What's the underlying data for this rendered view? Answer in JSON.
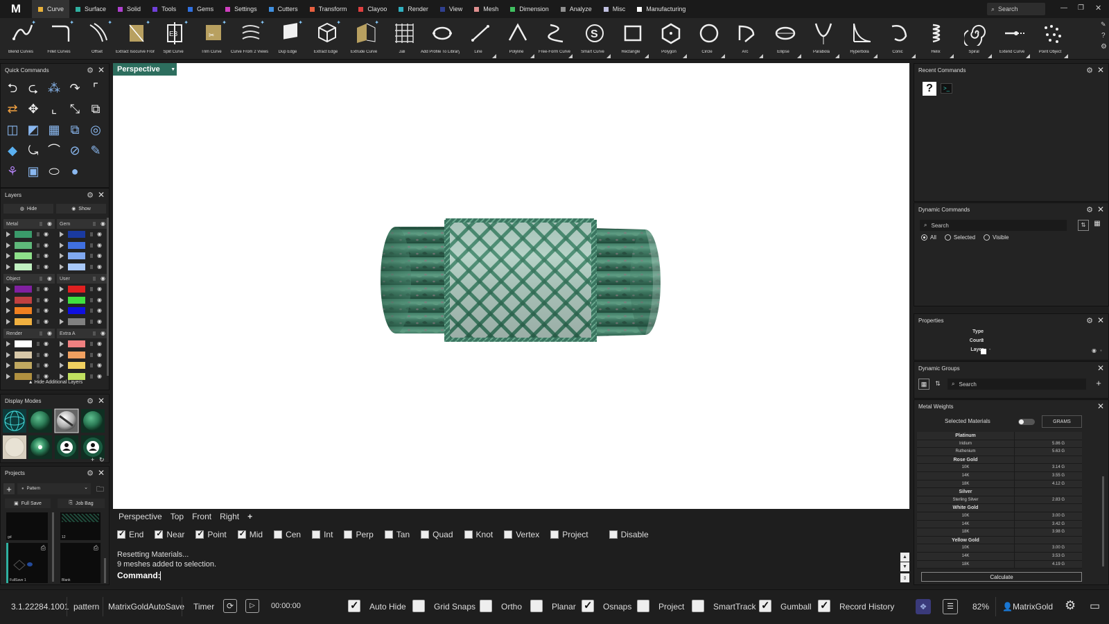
{
  "app": {
    "logo": "M"
  },
  "menubar": {
    "items": [
      {
        "label": "Curve",
        "color": "#e8b13a",
        "active": true
      },
      {
        "label": "Surface",
        "color": "#2fb0a0"
      },
      {
        "label": "Solid",
        "color": "#b040d0"
      },
      {
        "label": "Tools",
        "color": "#7040d8"
      },
      {
        "label": "Gems",
        "color": "#3070e0"
      },
      {
        "label": "Settings",
        "color": "#d040c0"
      },
      {
        "label": "Cutters",
        "color": "#4090e0"
      },
      {
        "label": "Transform",
        "color": "#e86040"
      },
      {
        "label": "Clayoo",
        "color": "#e04040"
      },
      {
        "label": "Render",
        "color": "#30b0c0"
      },
      {
        "label": "View",
        "color": "#304090"
      },
      {
        "label": "Mesh",
        "color": "#e09090"
      },
      {
        "label": "Dimension",
        "color": "#40c060"
      },
      {
        "label": "Analyze",
        "color": "#909090"
      },
      {
        "label": "Misc",
        "color": "#c0c0e0"
      },
      {
        "label": "Manufacturing",
        "color": "#ffffff"
      }
    ],
    "search_placeholder": "Search"
  },
  "toolbar": {
    "tools": [
      {
        "label": "Blend Curves",
        "icon": "blend-curves-icon"
      },
      {
        "label": "Fillet Curves",
        "icon": "fillet-curves-icon"
      },
      {
        "label": "Offset",
        "icon": "offset-icon"
      },
      {
        "label": "Extract Isocurve From...",
        "icon": "extract-isocurve-icon"
      },
      {
        "label": "Split Curve",
        "icon": "split-curve-icon"
      },
      {
        "label": "Trim Curve",
        "icon": "trim-curve-icon"
      },
      {
        "label": "Curve From 2 Views",
        "icon": "curve-from-2-views-icon"
      },
      {
        "label": "Dup Edge",
        "icon": "dup-edge-icon"
      },
      {
        "label": "Extract Edge",
        "icon": "extract-edge-icon"
      },
      {
        "label": "Extrude Curve",
        "icon": "extrude-curve-icon"
      },
      {
        "label": "Jali",
        "icon": "jali-icon"
      },
      {
        "label": "Add Profile To Library",
        "icon": "add-profile-icon"
      },
      {
        "label": "Line",
        "icon": "line-icon"
      },
      {
        "label": "Polyline",
        "icon": "polyline-icon"
      },
      {
        "label": "Free-Form Curve",
        "icon": "free-form-curve-icon"
      },
      {
        "label": "Smart Curve",
        "icon": "smart-curve-icon"
      },
      {
        "label": "Rectangle",
        "icon": "rectangle-icon"
      },
      {
        "label": "Polygon",
        "icon": "polygon-icon"
      },
      {
        "label": "Circle",
        "icon": "circle-icon"
      },
      {
        "label": "Arc",
        "icon": "arc-icon"
      },
      {
        "label": "Ellipse",
        "icon": "ellipse-icon"
      },
      {
        "label": "Parabola",
        "icon": "parabola-icon"
      },
      {
        "label": "Hyperbola",
        "icon": "hyperbola-icon"
      },
      {
        "label": "Conic",
        "icon": "conic-icon"
      },
      {
        "label": "Helix",
        "icon": "helix-icon"
      },
      {
        "label": "Spiral",
        "icon": "spiral-icon"
      },
      {
        "label": "Extend Curve",
        "icon": "extend-curve-icon"
      },
      {
        "label": "Point Object",
        "icon": "point-object-icon"
      }
    ]
  },
  "quick_commands": {
    "title": "Quick Commands"
  },
  "layers": {
    "title": "Layers",
    "hide_label": "Hide",
    "show_label": "Show",
    "groups": [
      {
        "name": "Metal",
        "colors": [
          "#3a9a6a",
          "#5fb87a",
          "#8ee08a",
          "#c0f0c0"
        ]
      },
      {
        "name": "Gem",
        "colors": [
          "#1a3aa0",
          "#4070e0",
          "#80a8f0",
          "#a8c8f8"
        ]
      },
      {
        "name": "Object",
        "colors": [
          "#8020a0",
          "#c04040",
          "#f08020",
          "#f0b040"
        ]
      },
      {
        "name": "User",
        "colors": [
          "#e02020",
          "#40e040",
          "#1010e0",
          "#808080"
        ]
      },
      {
        "name": "Render",
        "colors": [
          "#ffffff",
          "#d8c8a8",
          "#c0a860",
          "#b09040"
        ]
      },
      {
        "name": "Extra A",
        "colors": [
          "#f08080",
          "#f0a060",
          "#f0d060",
          "#c0e060"
        ]
      }
    ],
    "hide_additional": "Hide Additional Layers"
  },
  "display_modes": {
    "title": "Display Modes"
  },
  "projects": {
    "title": "Projects",
    "selected": "Pattern",
    "full_save": "Full Save",
    "job_bag": "Job Bag",
    "thumbs": [
      {
        "label": "gd"
      },
      {
        "label": "12"
      },
      {
        "label": "FullSave 1"
      },
      {
        "label": "Blank"
      }
    ]
  },
  "viewport": {
    "active_tab": "Perspective"
  },
  "view_tabs": [
    "Perspective",
    "Top",
    "Front",
    "Right"
  ],
  "view_tab_add": "+",
  "snaps": [
    {
      "label": "End",
      "checked": true
    },
    {
      "label": "Near",
      "checked": true
    },
    {
      "label": "Point",
      "checked": true
    },
    {
      "label": "Mid",
      "checked": true
    },
    {
      "label": "Cen",
      "checked": false
    },
    {
      "label": "Int",
      "checked": false
    },
    {
      "label": "Perp",
      "checked": false
    },
    {
      "label": "Tan",
      "checked": false
    },
    {
      "label": "Quad",
      "checked": false
    },
    {
      "label": "Knot",
      "checked": false
    },
    {
      "label": "Vertex",
      "checked": false
    },
    {
      "label": "Project",
      "checked": false
    },
    {
      "label": "Disable",
      "checked": false
    }
  ],
  "command": {
    "history": [
      "Resetting Materials...",
      "9 meshes added to selection."
    ],
    "prompt": "Command:"
  },
  "recent_commands": {
    "title": "Recent Commands"
  },
  "dynamic_commands": {
    "title": "Dynamic Commands",
    "search_placeholder": "Search",
    "filters": [
      {
        "label": "All",
        "checked": true
      },
      {
        "label": "Selected",
        "checked": false
      },
      {
        "label": "Visible",
        "checked": false
      }
    ]
  },
  "properties": {
    "title": "Properties",
    "rows": [
      {
        "key": "Type",
        "value": "-"
      },
      {
        "key": "Count",
        "value": "0"
      },
      {
        "key": "Layer",
        "value": "-"
      }
    ]
  },
  "dynamic_groups": {
    "title": "Dynamic Groups",
    "search_placeholder": "Search"
  },
  "metal_weights": {
    "title": "Metal Weights",
    "selected_materials": "Selected Materials",
    "unit": "GRAMS",
    "rows": [
      {
        "name": "Platinum",
        "value": "",
        "head": true
      },
      {
        "name": "Iridium",
        "value": "5.86 G"
      },
      {
        "name": "Ruthenium",
        "value": "5.63 G"
      },
      {
        "name": "Rose Gold",
        "value": "",
        "head": true
      },
      {
        "name": "10K",
        "value": "3.14 G"
      },
      {
        "name": "14K",
        "value": "3.55 G"
      },
      {
        "name": "18K",
        "value": "4.12 G"
      },
      {
        "name": "Silver",
        "value": "",
        "head": true
      },
      {
        "name": "Sterling Silver",
        "value": "2.83 G"
      },
      {
        "name": "White Gold",
        "value": "",
        "head": true
      },
      {
        "name": "10K",
        "value": "3.00 G"
      },
      {
        "name": "14K",
        "value": "3.42 G"
      },
      {
        "name": "18K",
        "value": "3.98 G"
      },
      {
        "name": "Yellow Gold",
        "value": "",
        "head": true
      },
      {
        "name": "10K",
        "value": "3.00 G"
      },
      {
        "name": "14K",
        "value": "3.53 G"
      },
      {
        "name": "18K",
        "value": "4.19 G"
      }
    ],
    "calculate": "Calculate"
  },
  "status": {
    "version": "3.1.22284.1001",
    "project": "pattern",
    "autosave": "MatrixGoldAutoSave",
    "timer_label": "Timer",
    "timer_value": "00:00:00",
    "toggles": [
      {
        "label": "Auto Hide",
        "checked": true
      },
      {
        "label": "Grid Snaps",
        "checked": false
      },
      {
        "label": "Ortho",
        "checked": false
      },
      {
        "label": "Planar",
        "checked": false
      },
      {
        "label": "Osnaps",
        "checked": true
      },
      {
        "label": "Project",
        "checked": false
      },
      {
        "label": "SmartTrack",
        "checked": false
      },
      {
        "label": "Gumball",
        "checked": true
      },
      {
        "label": "Record History",
        "checked": true
      }
    ],
    "zoom": "82%",
    "user": "MatrixGold"
  }
}
